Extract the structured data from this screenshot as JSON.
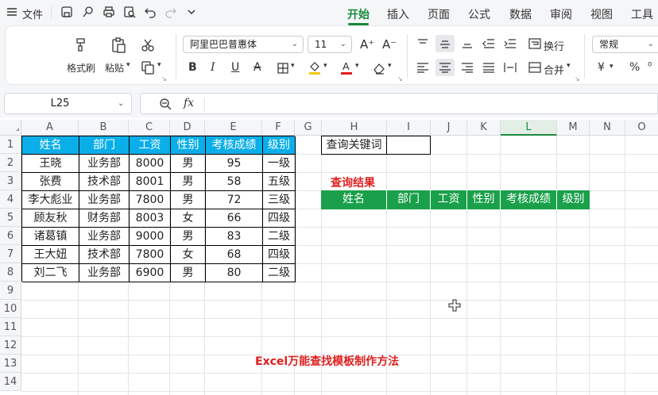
{
  "menu": {
    "file_label": "文件",
    "tabs": [
      "开始",
      "插入",
      "页面",
      "公式",
      "数据",
      "审阅",
      "视图",
      "工具"
    ],
    "active_tab": "开始"
  },
  "ribbon": {
    "format_painter": "格式刷",
    "paste": "粘贴",
    "font_name": "阿里巴巴普惠体",
    "font_size": "11",
    "wrap_text": "换行",
    "number_format": "常规",
    "merge": "合并",
    "bold": "B",
    "italic": "I",
    "underline": "U",
    "strikethrough": "A",
    "currency": "¥",
    "percent": "%",
    "font_color": "#e01f1f",
    "fill_color": "#f2c811"
  },
  "formula_bar": {
    "cell_ref": "L25",
    "fx_label": "fx",
    "formula": ""
  },
  "sheet": {
    "columns": [
      "A",
      "B",
      "C",
      "D",
      "E",
      "F",
      "G",
      "H",
      "I",
      "J",
      "K",
      "L",
      "M",
      "N",
      "O"
    ],
    "selected_column": "L",
    "rows": [
      "1",
      "2",
      "3",
      "4",
      "5",
      "6",
      "7",
      "8",
      "9",
      "10",
      "11",
      "12",
      "13",
      "14"
    ],
    "main_table": {
      "headers": [
        "姓名",
        "部门",
        "工资",
        "性别",
        "考核成绩",
        "级别"
      ],
      "rows": [
        [
          "王晓",
          "业务部",
          "8000",
          "男",
          "95",
          "一级"
        ],
        [
          "张费",
          "技术部",
          "8001",
          "男",
          "58",
          "五级"
        ],
        [
          "李大彪业",
          "业务部",
          "7800",
          "男",
          "72",
          "三级"
        ],
        [
          "顾友秋",
          "财务部",
          "8003",
          "女",
          "66",
          "四级"
        ],
        [
          "诸葛镇",
          "业务部",
          "9000",
          "男",
          "83",
          "二级"
        ],
        [
          "王大妞",
          "技术部",
          "7800",
          "女",
          "68",
          "四级"
        ],
        [
          "刘二飞",
          "业务部",
          "6900",
          "男",
          "80",
          "二级"
        ]
      ],
      "header_color": "#0aaee8"
    },
    "query_label": "查询关键词",
    "query_value": "",
    "result_title": "查询结果",
    "result_headers": [
      "姓名",
      "部门",
      "工资",
      "性别",
      "考核成绩",
      "级别"
    ],
    "result_header_color": "#1aa04a",
    "footer_title": "Excel万能查找模板制作方法",
    "accent_red": "#e01f1f"
  }
}
